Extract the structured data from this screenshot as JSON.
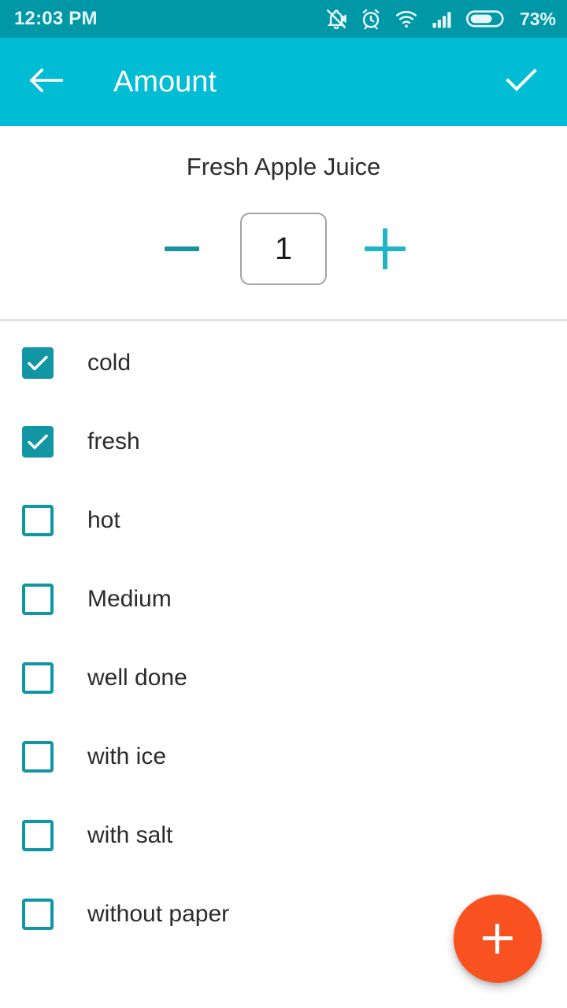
{
  "status_bar": {
    "clock": "12:03 PM",
    "battery_percent": "73%",
    "icons": [
      "bell-muted-icon",
      "alarm-clock-icon",
      "wifi-icon",
      "signal-bars-icon",
      "battery-icon"
    ],
    "background_color": "#0097a7"
  },
  "app_bar": {
    "back_label": "back-arrow",
    "title": "Amount",
    "done_label": "confirm-check",
    "background_color": "#00bcd4"
  },
  "amount": {
    "item_name": "Fresh Apple Juice",
    "decrement_label": "−",
    "quantity": "1",
    "increment_label": "+",
    "minus_color": "#17919e",
    "plus_color": "#21b4c4"
  },
  "options": {
    "accent_color": "#1296a3",
    "items": [
      {
        "label": "cold",
        "checked": true
      },
      {
        "label": "fresh",
        "checked": true
      },
      {
        "label": "hot",
        "checked": false
      },
      {
        "label": "Medium",
        "checked": false
      },
      {
        "label": "well done",
        "checked": false
      },
      {
        "label": "with ice",
        "checked": false
      },
      {
        "label": "with salt",
        "checked": false
      },
      {
        "label": "without paper",
        "checked": false
      }
    ]
  },
  "fab": {
    "label": "+",
    "color": "#f9511f"
  }
}
